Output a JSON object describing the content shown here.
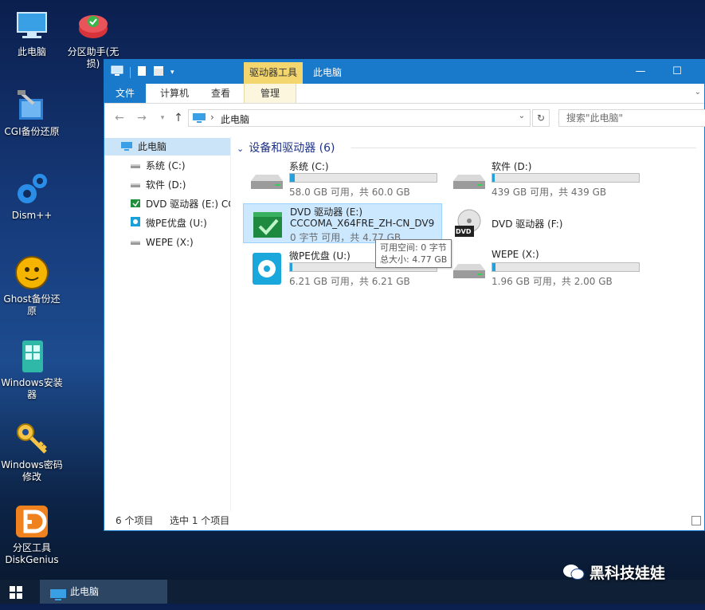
{
  "desktop": {
    "icons": [
      {
        "label": "此电脑",
        "icon": "this-pc-icon"
      },
      {
        "label": "分区助手(无损)",
        "icon": "partition-assistant-icon"
      },
      {
        "label": "CGI备份还原",
        "icon": "cgi-backup-icon"
      },
      {
        "label": "Dism++",
        "icon": "dism-icon"
      },
      {
        "label": "Ghost备份还原",
        "icon": "ghost-icon"
      },
      {
        "label": "Windows安装器",
        "icon": "windows-installer-icon"
      },
      {
        "label": "Windows密码修改",
        "icon": "key-icon"
      },
      {
        "label": "分区工具DiskGenius",
        "icon": "diskgenius-icon"
      }
    ]
  },
  "window": {
    "title": "此电脑",
    "context_tab": "驱动器工具",
    "ribbon_tabs": [
      "文件",
      "计算机",
      "查看",
      "管理"
    ],
    "address": "此电脑",
    "search_placeholder": "搜索\"此电脑\"",
    "nav": {
      "root": "此电脑",
      "items": [
        "系统 (C:)",
        "软件 (D:)",
        "DVD 驱动器 (E:) CC",
        "微PE优盘 (U:)",
        "WEPE (X:)"
      ]
    },
    "group_header": "设备和驱动器 (6)",
    "drives": [
      {
        "name": "系统 (C:)",
        "info": "58.0 GB 可用，共 60.0 GB",
        "used_fraction": 0.03
      },
      {
        "name": "软件 (D:)",
        "info": "439 GB 可用，共 439 GB",
        "used_fraction": 0.0
      },
      {
        "name": "DVD 驱动器 (E:)",
        "label": "CCCOMA_X64FRE_ZH-CN_DV9",
        "info": "0 字节 可用，共 4.77 GB"
      },
      {
        "name": "DVD 驱动器 (F:)"
      },
      {
        "name": "微PE优盘 (U:)",
        "info": "6.21 GB 可用，共 6.21 GB",
        "used_fraction": 0.0
      },
      {
        "name": "WEPE (X:)",
        "info": "1.96 GB 可用，共 2.00 GB",
        "used_fraction": 0.02
      }
    ],
    "tooltip": {
      "line1": "可用空间: 0 字节",
      "line2": "总大小: 4.77 GB"
    },
    "status": {
      "count": "6 个项目",
      "selected": "选中 1 个项目"
    },
    "dvd_badge": "DVD"
  },
  "taskbar": {
    "app_label": "此电脑"
  },
  "watermark": "黑科技娃娃",
  "colors": {
    "accent": "#1979ca",
    "context_tab": "#f4d66e",
    "selection": "#cce8ff",
    "progress": "#26a0da"
  }
}
